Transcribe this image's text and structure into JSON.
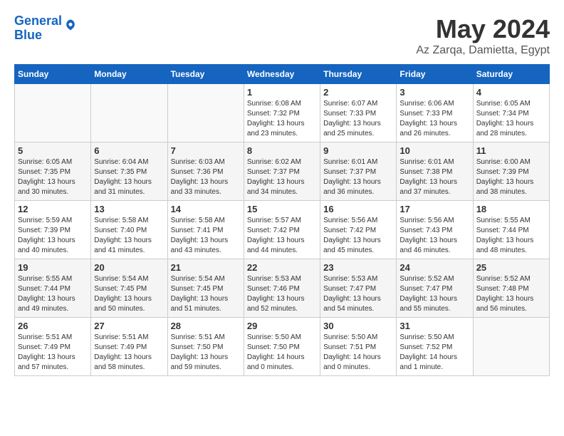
{
  "header": {
    "logo_line1": "General",
    "logo_line2": "Blue",
    "month_year": "May 2024",
    "location": "Az Zarqa, Damietta, Egypt"
  },
  "days_of_week": [
    "Sunday",
    "Monday",
    "Tuesday",
    "Wednesday",
    "Thursday",
    "Friday",
    "Saturday"
  ],
  "weeks": [
    [
      {
        "day": "",
        "info": ""
      },
      {
        "day": "",
        "info": ""
      },
      {
        "day": "",
        "info": ""
      },
      {
        "day": "1",
        "info": "Sunrise: 6:08 AM\nSunset: 7:32 PM\nDaylight: 13 hours\nand 23 minutes."
      },
      {
        "day": "2",
        "info": "Sunrise: 6:07 AM\nSunset: 7:33 PM\nDaylight: 13 hours\nand 25 minutes."
      },
      {
        "day": "3",
        "info": "Sunrise: 6:06 AM\nSunset: 7:33 PM\nDaylight: 13 hours\nand 26 minutes."
      },
      {
        "day": "4",
        "info": "Sunrise: 6:05 AM\nSunset: 7:34 PM\nDaylight: 13 hours\nand 28 minutes."
      }
    ],
    [
      {
        "day": "5",
        "info": "Sunrise: 6:05 AM\nSunset: 7:35 PM\nDaylight: 13 hours\nand 30 minutes."
      },
      {
        "day": "6",
        "info": "Sunrise: 6:04 AM\nSunset: 7:35 PM\nDaylight: 13 hours\nand 31 minutes."
      },
      {
        "day": "7",
        "info": "Sunrise: 6:03 AM\nSunset: 7:36 PM\nDaylight: 13 hours\nand 33 minutes."
      },
      {
        "day": "8",
        "info": "Sunrise: 6:02 AM\nSunset: 7:37 PM\nDaylight: 13 hours\nand 34 minutes."
      },
      {
        "day": "9",
        "info": "Sunrise: 6:01 AM\nSunset: 7:37 PM\nDaylight: 13 hours\nand 36 minutes."
      },
      {
        "day": "10",
        "info": "Sunrise: 6:01 AM\nSunset: 7:38 PM\nDaylight: 13 hours\nand 37 minutes."
      },
      {
        "day": "11",
        "info": "Sunrise: 6:00 AM\nSunset: 7:39 PM\nDaylight: 13 hours\nand 38 minutes."
      }
    ],
    [
      {
        "day": "12",
        "info": "Sunrise: 5:59 AM\nSunset: 7:39 PM\nDaylight: 13 hours\nand 40 minutes."
      },
      {
        "day": "13",
        "info": "Sunrise: 5:58 AM\nSunset: 7:40 PM\nDaylight: 13 hours\nand 41 minutes."
      },
      {
        "day": "14",
        "info": "Sunrise: 5:58 AM\nSunset: 7:41 PM\nDaylight: 13 hours\nand 43 minutes."
      },
      {
        "day": "15",
        "info": "Sunrise: 5:57 AM\nSunset: 7:42 PM\nDaylight: 13 hours\nand 44 minutes."
      },
      {
        "day": "16",
        "info": "Sunrise: 5:56 AM\nSunset: 7:42 PM\nDaylight: 13 hours\nand 45 minutes."
      },
      {
        "day": "17",
        "info": "Sunrise: 5:56 AM\nSunset: 7:43 PM\nDaylight: 13 hours\nand 46 minutes."
      },
      {
        "day": "18",
        "info": "Sunrise: 5:55 AM\nSunset: 7:44 PM\nDaylight: 13 hours\nand 48 minutes."
      }
    ],
    [
      {
        "day": "19",
        "info": "Sunrise: 5:55 AM\nSunset: 7:44 PM\nDaylight: 13 hours\nand 49 minutes."
      },
      {
        "day": "20",
        "info": "Sunrise: 5:54 AM\nSunset: 7:45 PM\nDaylight: 13 hours\nand 50 minutes."
      },
      {
        "day": "21",
        "info": "Sunrise: 5:54 AM\nSunset: 7:45 PM\nDaylight: 13 hours\nand 51 minutes."
      },
      {
        "day": "22",
        "info": "Sunrise: 5:53 AM\nSunset: 7:46 PM\nDaylight: 13 hours\nand 52 minutes."
      },
      {
        "day": "23",
        "info": "Sunrise: 5:53 AM\nSunset: 7:47 PM\nDaylight: 13 hours\nand 54 minutes."
      },
      {
        "day": "24",
        "info": "Sunrise: 5:52 AM\nSunset: 7:47 PM\nDaylight: 13 hours\nand 55 minutes."
      },
      {
        "day": "25",
        "info": "Sunrise: 5:52 AM\nSunset: 7:48 PM\nDaylight: 13 hours\nand 56 minutes."
      }
    ],
    [
      {
        "day": "26",
        "info": "Sunrise: 5:51 AM\nSunset: 7:49 PM\nDaylight: 13 hours\nand 57 minutes."
      },
      {
        "day": "27",
        "info": "Sunrise: 5:51 AM\nSunset: 7:49 PM\nDaylight: 13 hours\nand 58 minutes."
      },
      {
        "day": "28",
        "info": "Sunrise: 5:51 AM\nSunset: 7:50 PM\nDaylight: 13 hours\nand 59 minutes."
      },
      {
        "day": "29",
        "info": "Sunrise: 5:50 AM\nSunset: 7:50 PM\nDaylight: 14 hours\nand 0 minutes."
      },
      {
        "day": "30",
        "info": "Sunrise: 5:50 AM\nSunset: 7:51 PM\nDaylight: 14 hours\nand 0 minutes."
      },
      {
        "day": "31",
        "info": "Sunrise: 5:50 AM\nSunset: 7:52 PM\nDaylight: 14 hours\nand 1 minute."
      },
      {
        "day": "",
        "info": ""
      }
    ]
  ]
}
